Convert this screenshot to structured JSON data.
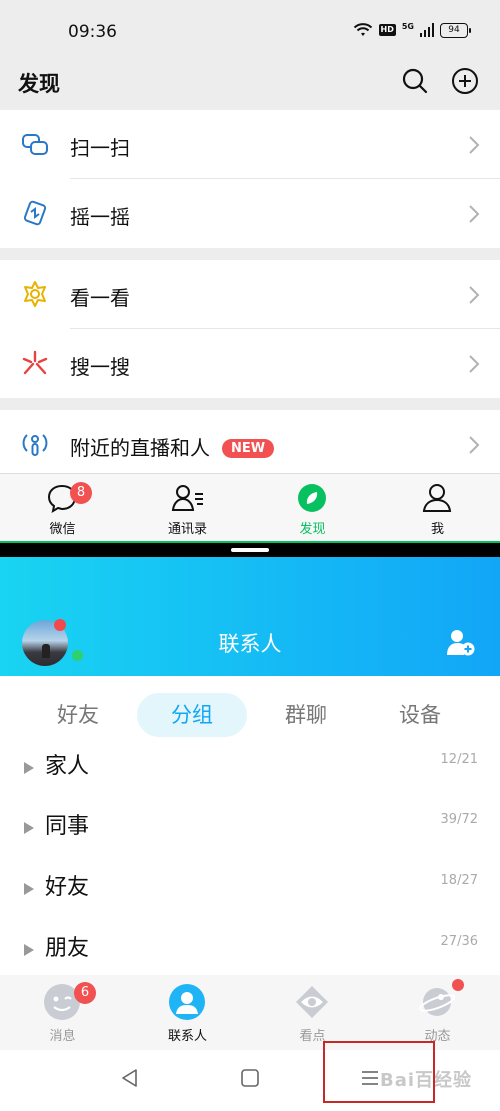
{
  "status_bar": {
    "time": "09:36",
    "hd": "HD",
    "network": "5G",
    "battery": "94"
  },
  "wechat": {
    "title": "发现",
    "menu": [
      {
        "label": "扫一扫",
        "icon": "scan-icon"
      },
      {
        "label": "摇一摇",
        "icon": "shake-icon"
      },
      {
        "label": "看一看",
        "icon": "top-stories-icon"
      },
      {
        "label": "搜一搜",
        "icon": "search-star-icon"
      },
      {
        "label": "附近的直播和人",
        "icon": "nearby-icon",
        "badge": "NEW"
      }
    ],
    "tabs": [
      {
        "label": "微信",
        "icon": "chat-bubble-icon",
        "badge": "8"
      },
      {
        "label": "通讯录",
        "icon": "contacts-icon"
      },
      {
        "label": "发现",
        "icon": "compass-icon",
        "active": true
      },
      {
        "label": "我",
        "icon": "person-icon"
      }
    ],
    "accent": "#07c160"
  },
  "qq": {
    "title": "联系人",
    "segments": [
      "好友",
      "分组",
      "群聊",
      "设备"
    ],
    "active_segment": "分组",
    "groups": [
      {
        "name": "家人",
        "count": "12/21"
      },
      {
        "name": "同事",
        "count": "39/72"
      },
      {
        "name": "好友",
        "count": "18/27"
      },
      {
        "name": "朋友",
        "count": "27/36"
      }
    ],
    "tabs": [
      {
        "label": "消息",
        "icon": "message-face-icon",
        "badge": "6"
      },
      {
        "label": "联系人",
        "icon": "contacts-person-icon",
        "active": true
      },
      {
        "label": "看点",
        "icon": "eye-icon"
      },
      {
        "label": "动态",
        "icon": "planet-icon"
      }
    ],
    "accent": "#12a6f7"
  },
  "watermark": "Bai百经验"
}
